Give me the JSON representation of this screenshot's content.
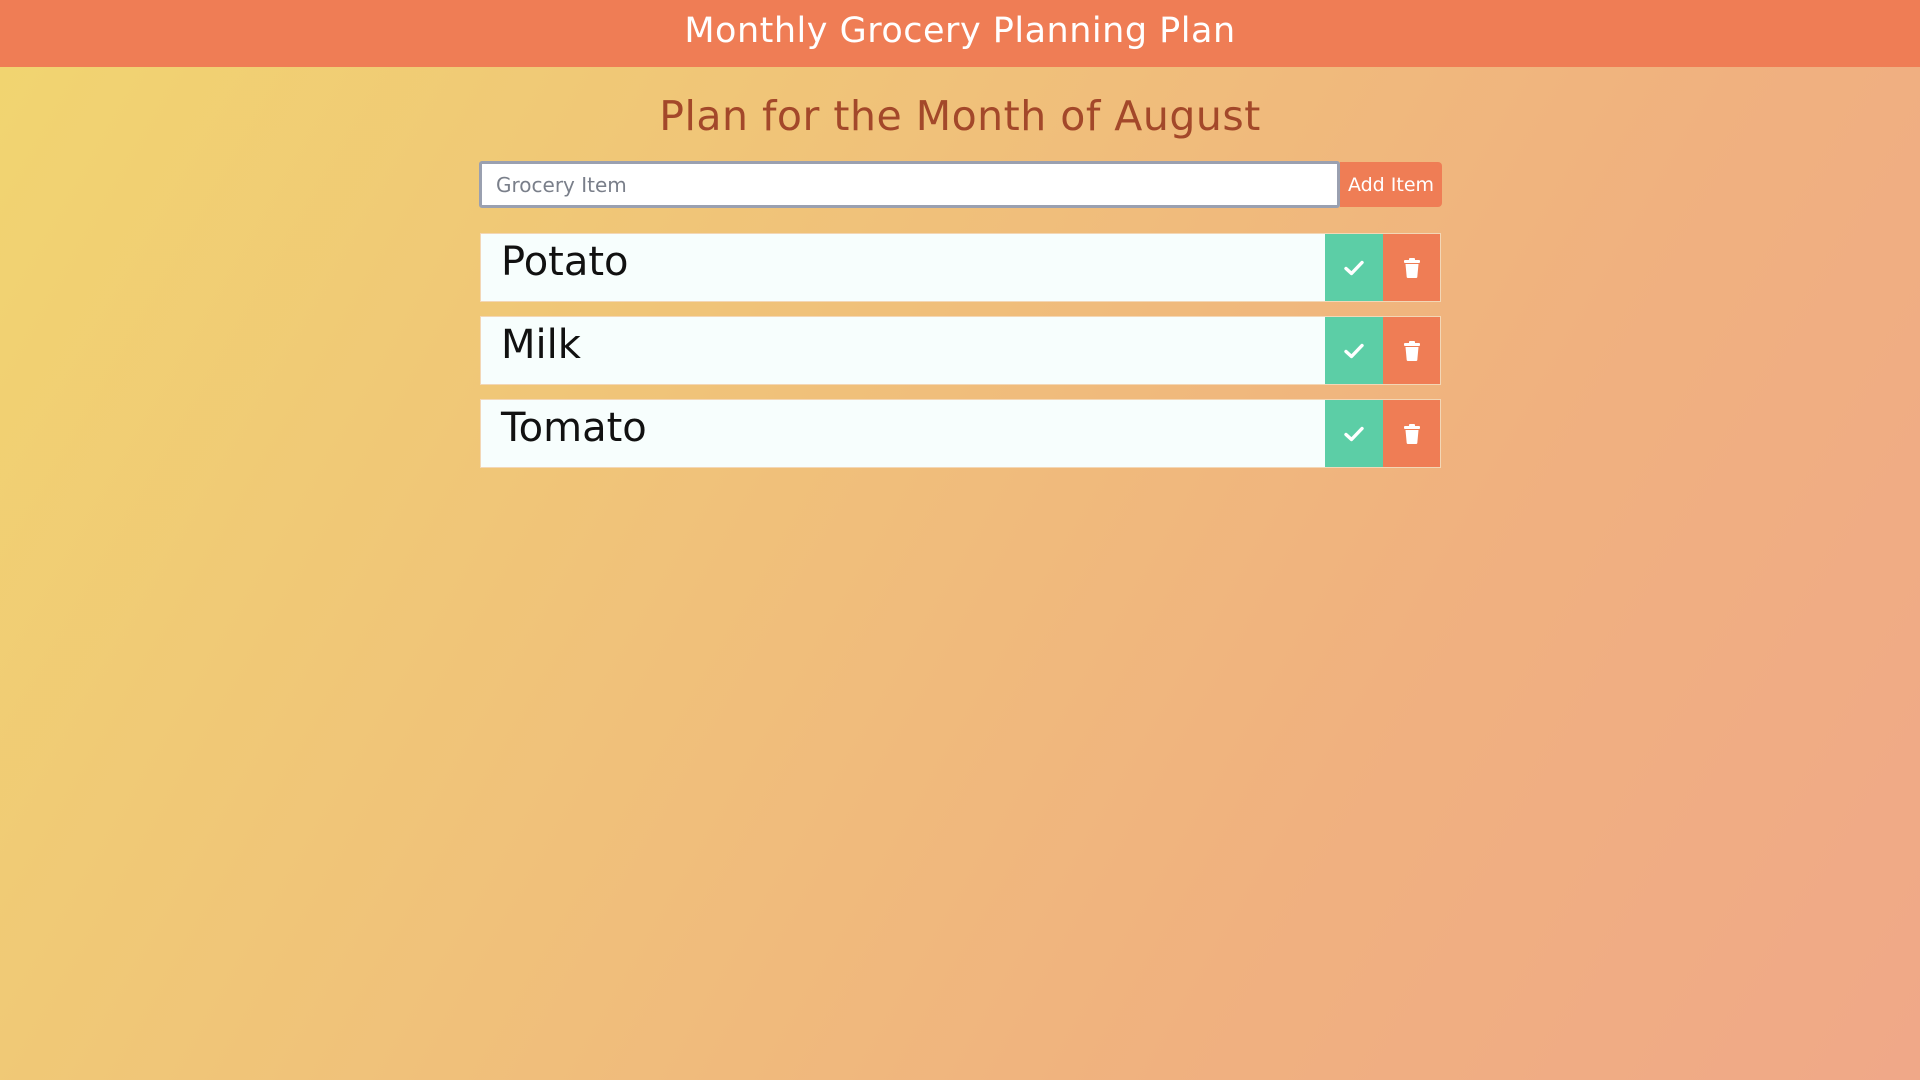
{
  "header": {
    "title": "Monthly Grocery Planning Plan"
  },
  "plan": {
    "subtitle": "Plan for the Month of August"
  },
  "form": {
    "input_value": "",
    "input_placeholder": "Grocery Item",
    "add_label": "Add Item"
  },
  "items": [
    {
      "label": "Potato"
    },
    {
      "label": "Milk"
    },
    {
      "label": "Tomato"
    }
  ],
  "icons": {
    "complete": "check-icon",
    "delete": "trash-icon"
  },
  "colors": {
    "accent": "#ef7d55",
    "check": "#5ccea6",
    "subtitle": "#a3482a",
    "item_bg": "#f7fefd"
  }
}
